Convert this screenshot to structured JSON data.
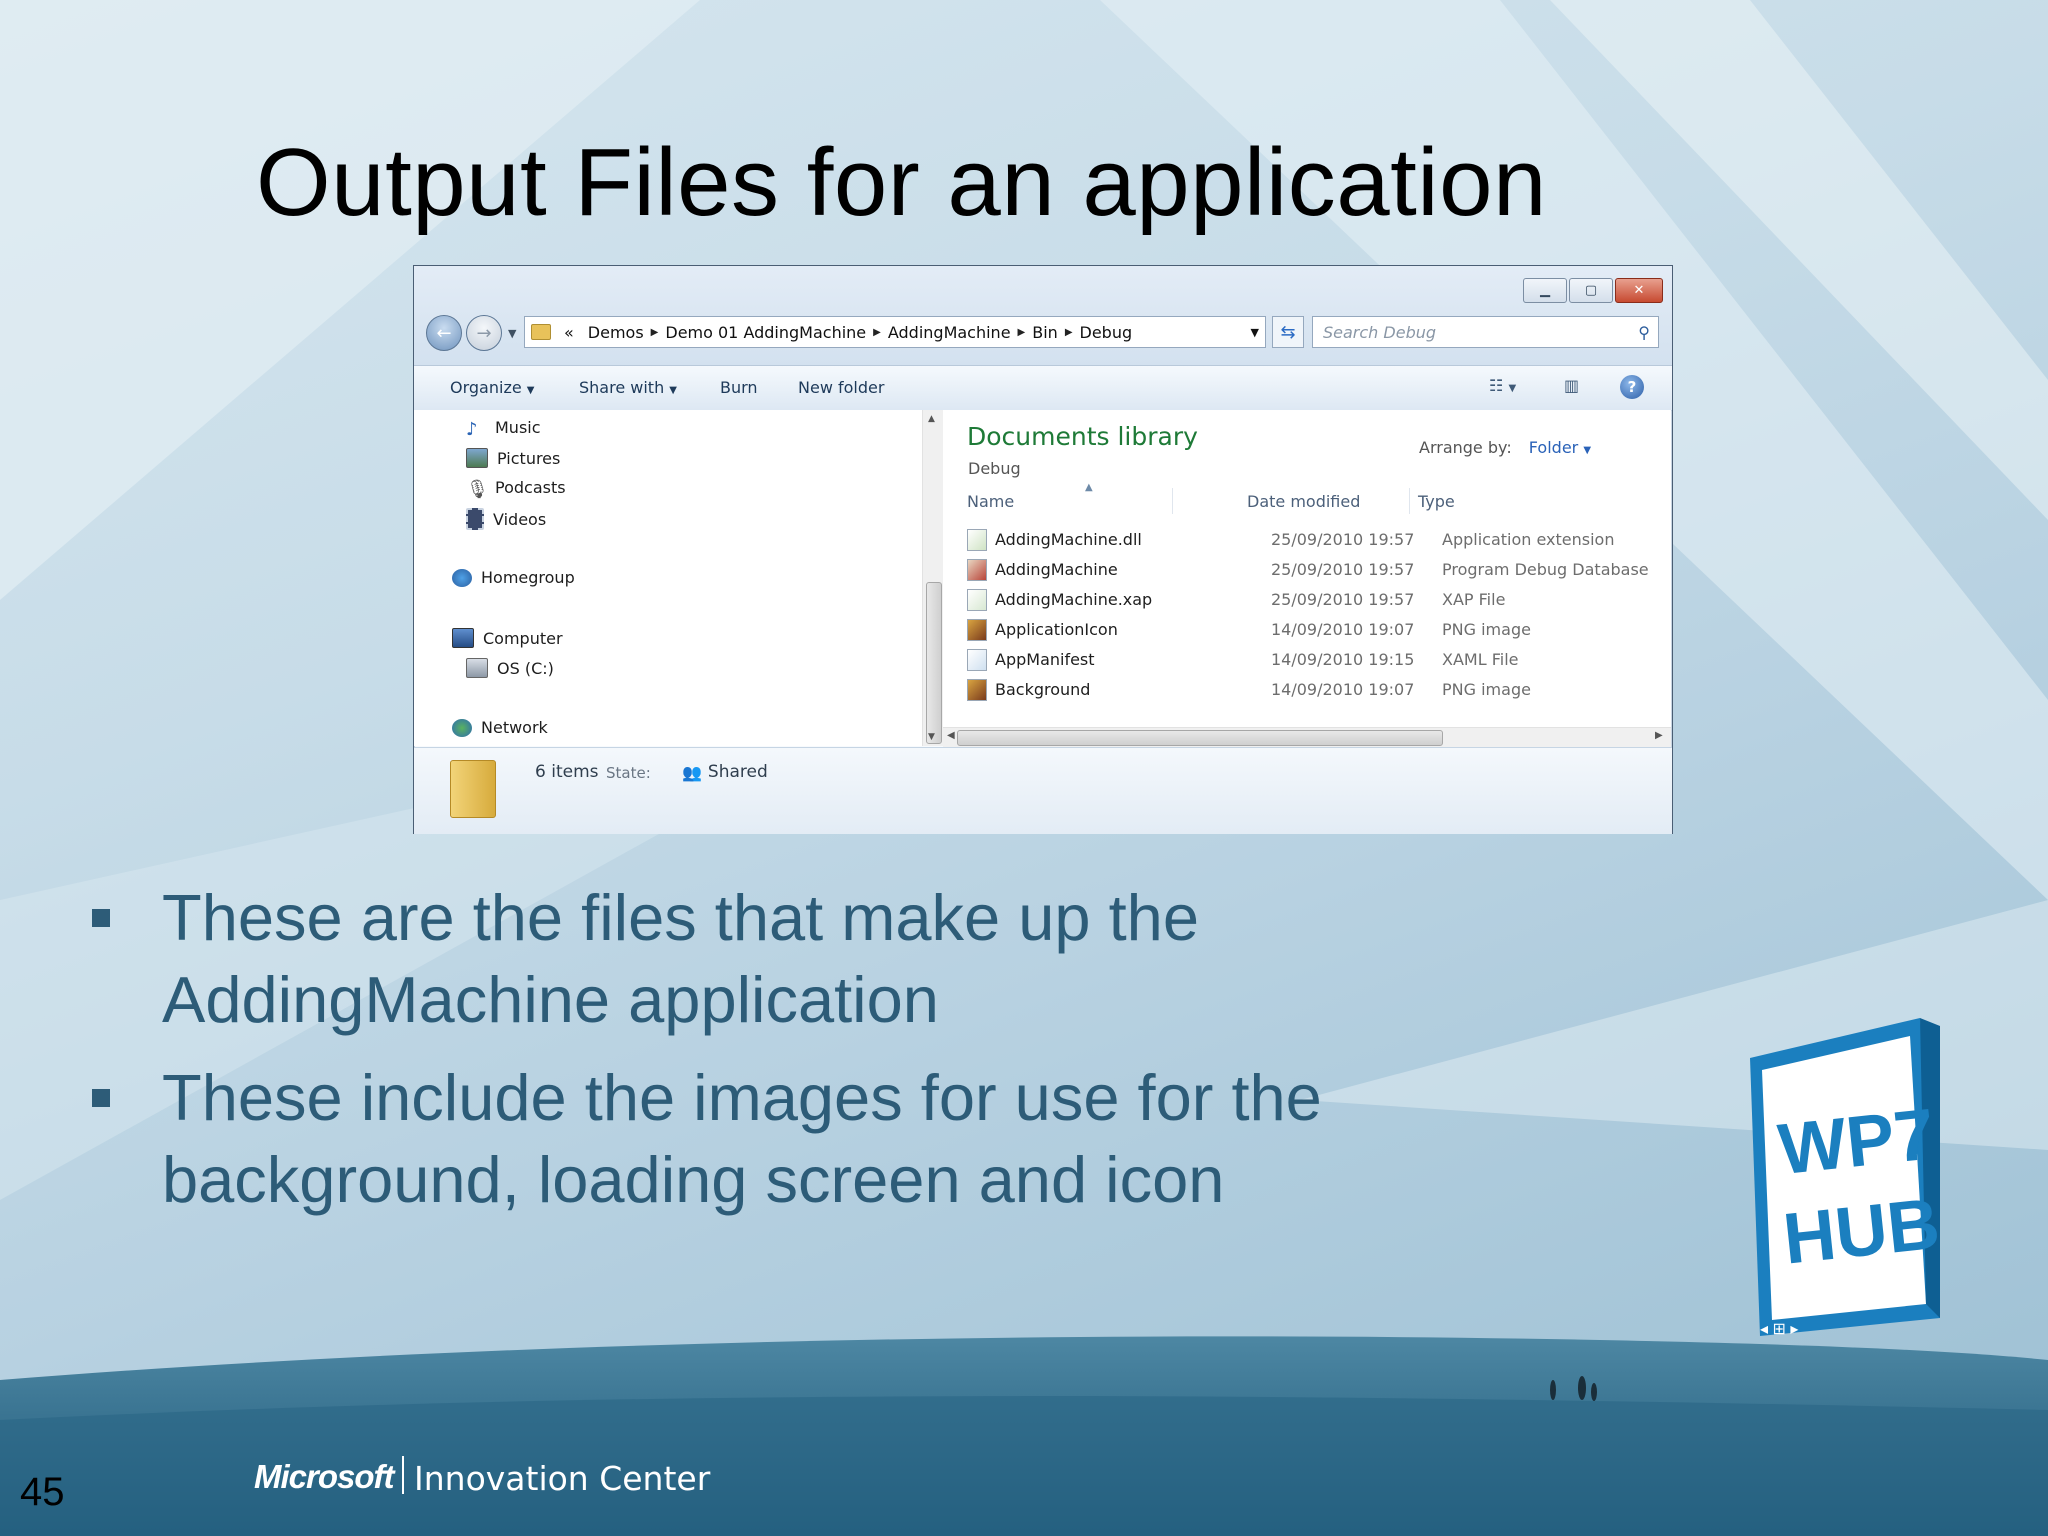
{
  "slide": {
    "title": "Output Files for an application",
    "page_number": "45",
    "bullets": [
      {
        "line1": "These are the files that make up the",
        "line2": "AddingMachine application"
      },
      {
        "line1": "These include the images for use for the",
        "line2": "background, loading screen and icon"
      }
    ],
    "footer": {
      "brand": "Microsoft",
      "center": "Innovation Center"
    },
    "badge": {
      "line1": "WP7",
      "line2": "HUB"
    }
  },
  "explorer": {
    "address": {
      "overflow": "«",
      "segments": [
        "Demos",
        "Demo 01 AddingMachine",
        "AddingMachine",
        "Bin",
        "Debug"
      ]
    },
    "search_placeholder": "Search Debug",
    "toolbar": {
      "organize": "Organize",
      "share_with": "Share with",
      "burn": "Burn",
      "new_folder": "New folder"
    },
    "nav_items": {
      "music": "Music",
      "pictures": "Pictures",
      "podcasts": "Podcasts",
      "videos": "Videos",
      "homegroup": "Homegroup",
      "computer": "Computer",
      "os_c": "OS (C:)",
      "network": "Network"
    },
    "library": {
      "title": "Documents library",
      "subtitle": "Debug",
      "arrange_by_label": "Arrange by:",
      "arrange_by_value": "Folder"
    },
    "columns": {
      "name": "Name",
      "date": "Date modified",
      "type": "Type"
    },
    "files": [
      {
        "name": "AddingMachine.dll",
        "date": "25/09/2010 19:57",
        "type": "Application extension"
      },
      {
        "name": "AddingMachine",
        "date": "25/09/2010 19:57",
        "type": "Program Debug Database"
      },
      {
        "name": "AddingMachine.xap",
        "date": "25/09/2010 19:57",
        "type": "XAP File"
      },
      {
        "name": "ApplicationIcon",
        "date": "14/09/2010 19:07",
        "type": "PNG image"
      },
      {
        "name": "AppManifest",
        "date": "14/09/2010 19:15",
        "type": "XAML File"
      },
      {
        "name": "Background",
        "date": "14/09/2010 19:07",
        "type": "PNG image"
      }
    ],
    "status": {
      "items": "6 items",
      "state_label": "State:",
      "state_value": "Shared"
    }
  }
}
